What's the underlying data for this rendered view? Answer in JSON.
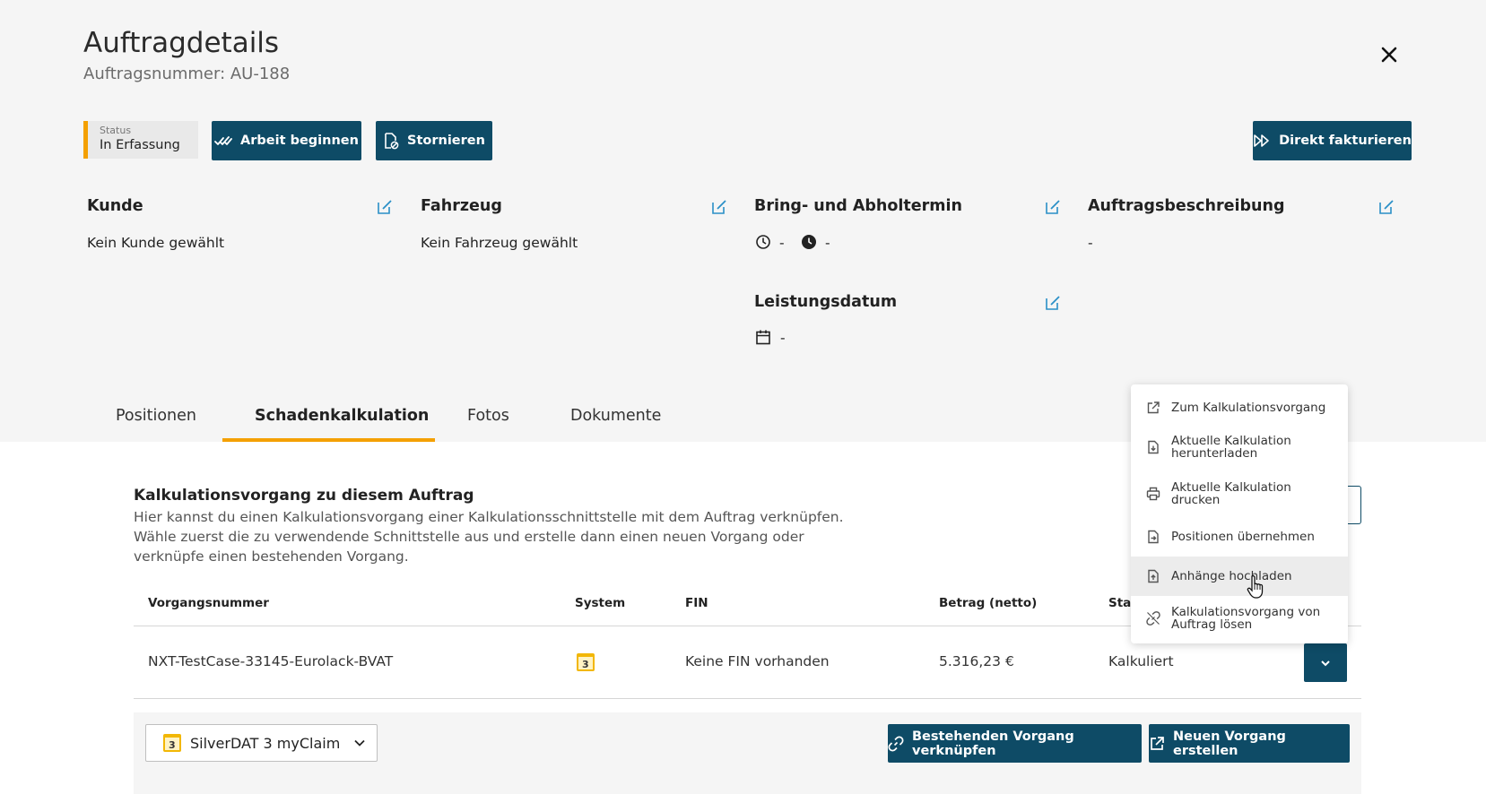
{
  "header": {
    "title": "Auftragdetails",
    "subtitle": "Auftragsnummer: AU-188",
    "close_icon": "close-icon"
  },
  "status": {
    "label": "Status",
    "value": "In Erfassung",
    "accent": "#f4a000"
  },
  "actions": {
    "start_work": "Arbeit beginnen",
    "cancel": "Stornieren",
    "invoice": "Direkt fakturieren"
  },
  "cards": {
    "customer": {
      "title": "Kunde",
      "value": "Kein Kunde gewählt"
    },
    "vehicle": {
      "title": "Fahrzeug",
      "value": "Kein Fahrzeug gewählt"
    },
    "appointment": {
      "title": "Bring- und Abholtermin",
      "bring": "-",
      "pickup": "-"
    },
    "description": {
      "title": "Auftragsbeschreibung",
      "value": "-"
    },
    "service_date": {
      "title": "Leistungsdatum",
      "value": "-"
    }
  },
  "tabs": [
    {
      "label": "Positionen",
      "active": false
    },
    {
      "label": "Schadenkalkulation",
      "active": true
    },
    {
      "label": "Fotos",
      "active": false
    },
    {
      "label": "Dokumente",
      "active": false
    }
  ],
  "section": {
    "title": "Kalkulationsvorgang zu diesem Auftrag",
    "description": "Hier kannst du einen Kalkulationsvorgang einer Kalkulationsschnittstelle mit dem Auftrag verknüpfen. Wähle zuerst die zu verwendende Schnittstelle aus und erstelle dann einen neuen Vorgang oder verknüpfe einen bestehenden Vorgang."
  },
  "table": {
    "columns": [
      "Vorgangsnummer",
      "System",
      "FIN",
      "Betrag (netto)",
      "Stat"
    ],
    "rows": [
      {
        "number": "NXT-TestCase-33145-Eurolack-BVAT",
        "system_icon": "silverdat-logo-icon",
        "fin": "Keine FIN vorhanden",
        "amount": "5.316,23 €",
        "status": "Kalkuliert"
      }
    ]
  },
  "footer": {
    "interface_select": "SilverDAT 3 myClaim",
    "link_existing": "Bestehenden Vorgang verknüpfen",
    "create_new": "Neuen Vorgang erstellen"
  },
  "dropdown_menu": {
    "items": [
      {
        "label1": "Zum Kalkulationsvorgang",
        "label2": "",
        "icon": "external-link-icon"
      },
      {
        "label1": "Aktuelle Kalkulation",
        "label2": "herunterladen",
        "icon": "file-download-icon"
      },
      {
        "label1": "Aktuelle Kalkulation",
        "label2": "drucken",
        "icon": "printer-icon"
      },
      {
        "label1": "Positionen übernehmen",
        "label2": "",
        "icon": "file-import-icon"
      },
      {
        "label1": "Anhänge hochladen",
        "label2": "",
        "icon": "file-upload-icon"
      },
      {
        "label1": "Kalkulationsvorgang von",
        "label2": "Auftrag lösen",
        "icon": "unlink-icon"
      }
    ]
  },
  "colors": {
    "primary": "#0e4b66",
    "accent": "#f4a000",
    "edit_icon": "#2a8fc7"
  }
}
